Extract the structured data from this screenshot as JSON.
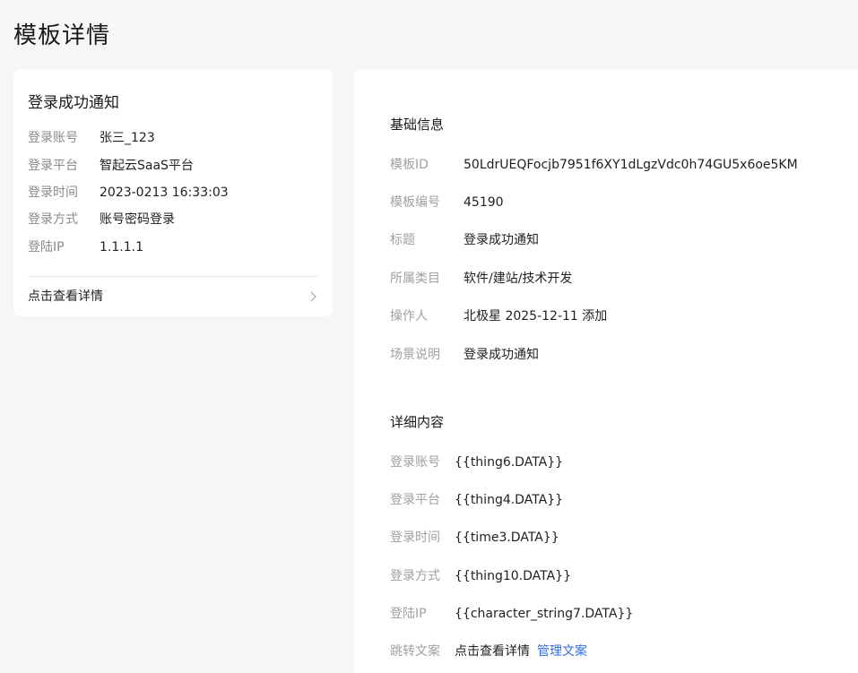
{
  "page": {
    "title": "模板详情"
  },
  "preview": {
    "title": "登录成功通知",
    "rows": [
      {
        "label": "登录账号",
        "value": "张三_123"
      },
      {
        "label": "登录平台",
        "value": "智起云SaaS平台"
      },
      {
        "label": "登录时间",
        "value": "2023-0213 16:33:03"
      },
      {
        "label": "登录方式",
        "value": "账号密码登录"
      },
      {
        "label": "登陆IP",
        "value": "1.1.1.1"
      }
    ],
    "link_label": "点击查看详情"
  },
  "basic_info": {
    "title": "基础信息",
    "rows": [
      {
        "label": "模板ID",
        "value": "50LdrUEQFocjb7951f6XY1dLgzVdc0h74GU5x6oe5KM"
      },
      {
        "label": "模板编号",
        "value": "45190"
      },
      {
        "label": "标题",
        "value": "登录成功通知"
      },
      {
        "label": "所属类目",
        "value": "软件/建站/技术开发"
      },
      {
        "label": "操作人",
        "value": "北极星 2025-12-11 添加"
      },
      {
        "label": "场景说明",
        "value": "登录成功通知"
      }
    ]
  },
  "detail_content": {
    "title": "详细内容",
    "rows": [
      {
        "label": "登录账号",
        "value": "{{thing6.DATA}}"
      },
      {
        "label": "登录平台",
        "value": "{{thing4.DATA}}"
      },
      {
        "label": "登录时间",
        "value": "{{time3.DATA}}"
      },
      {
        "label": "登录方式",
        "value": "{{thing10.DATA}}"
      },
      {
        "label": "登陆IP",
        "value": "{{character_string7.DATA}}"
      },
      {
        "label": "跳转文案",
        "value": "点击查看详情",
        "action": "管理文案"
      }
    ]
  },
  "colors": {
    "background": "#f5f6f8",
    "card": "#ffffff",
    "label": "#8a8a8a",
    "link": "#2f6fdc"
  }
}
